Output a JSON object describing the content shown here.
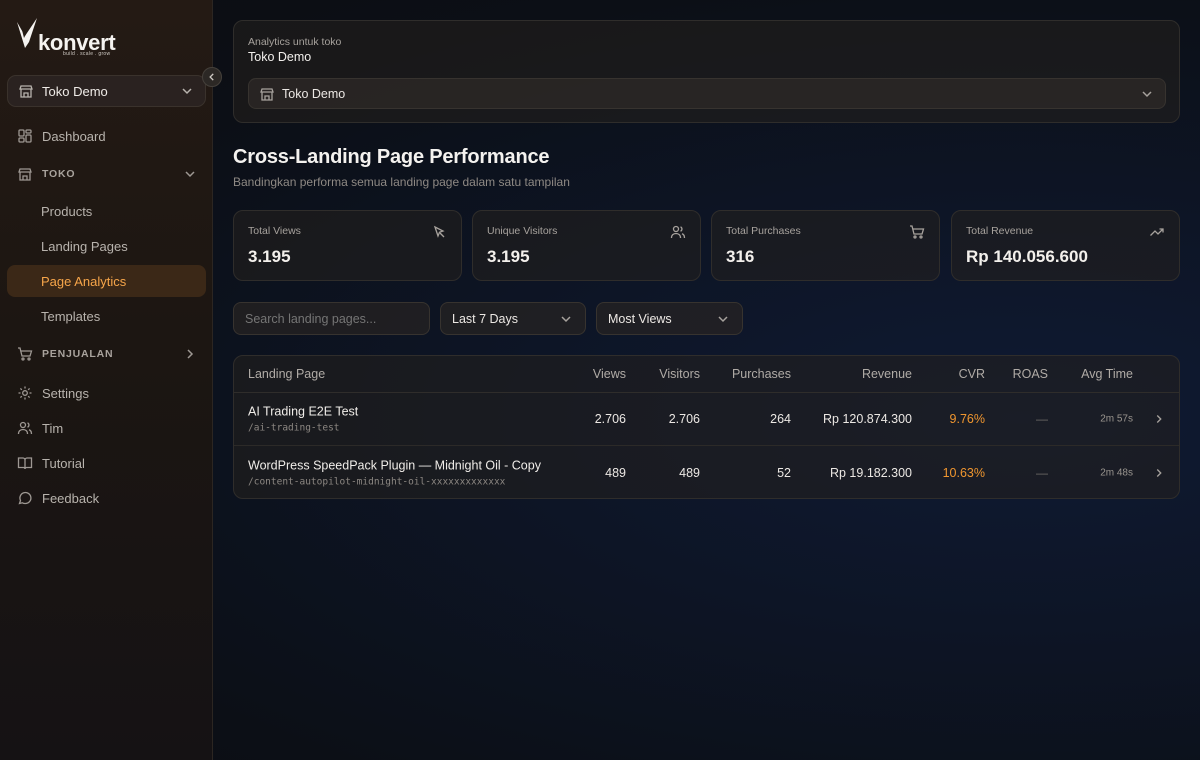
{
  "brand": {
    "name": "konvert",
    "tagline": "build . scale . grow"
  },
  "sidebar": {
    "store_selector": "Toko Demo",
    "items": [
      {
        "label": "Dashboard"
      },
      {
        "label": "TOKO"
      },
      {
        "label": "Products"
      },
      {
        "label": "Landing Pages"
      },
      {
        "label": "Page Analytics"
      },
      {
        "label": "Templates"
      },
      {
        "label": "PENJUALAN"
      },
      {
        "label": "Settings"
      },
      {
        "label": "Tim"
      },
      {
        "label": "Tutorial"
      },
      {
        "label": "Feedback"
      }
    ]
  },
  "header": {
    "label": "Analytics untuk toko",
    "store_name": "Toko Demo",
    "store_select": "Toko Demo"
  },
  "page": {
    "title": "Cross-Landing Page Performance",
    "subtitle": "Bandingkan performa semua landing page dalam satu tampilan"
  },
  "stats": [
    {
      "label": "Total Views",
      "value": "3.195"
    },
    {
      "label": "Unique Visitors",
      "value": "3.195"
    },
    {
      "label": "Total Purchases",
      "value": "316"
    },
    {
      "label": "Total Revenue",
      "value": "Rp 140.056.600"
    }
  ],
  "filters": {
    "search_placeholder": "Search landing pages...",
    "date_range": "Last 7 Days",
    "sort": "Most Views"
  },
  "table": {
    "columns": [
      "Landing Page",
      "Views",
      "Visitors",
      "Purchases",
      "Revenue",
      "CVR",
      "ROAS",
      "Avg Time"
    ],
    "rows": [
      {
        "name": "AI Trading E2E Test",
        "slug": "/ai-trading-test",
        "views": "2.706",
        "visitors": "2.706",
        "purchases": "264",
        "revenue": "Rp 120.874.300",
        "cvr": "9.76%",
        "roas": "—",
        "avg_time": "2m 57s"
      },
      {
        "name": "WordPress SpeedPack Plugin — Midnight Oil - Copy",
        "slug": "/content-autopilot-midnight-oil-xxxxxxxxxxxxx",
        "views": "489",
        "visitors": "489",
        "purchases": "52",
        "revenue": "Rp 19.182.300",
        "cvr": "10.63%",
        "roas": "—",
        "avg_time": "2m 48s"
      }
    ]
  },
  "colors": {
    "accent": "#f0962f",
    "active_bg": "#3b2817"
  }
}
